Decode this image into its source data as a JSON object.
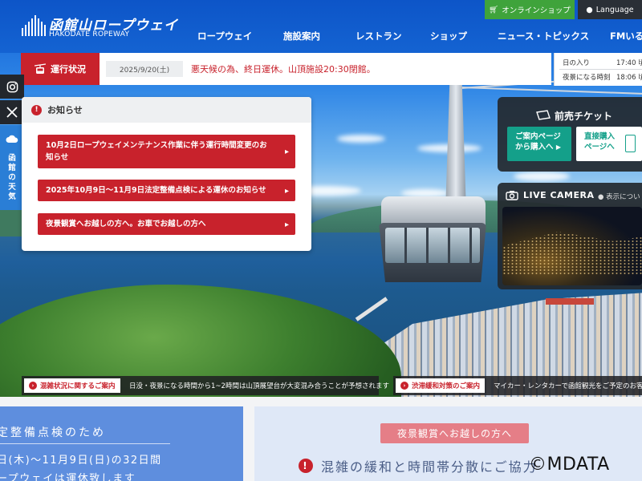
{
  "header": {
    "logo_jp": "函館山ロープウェイ",
    "logo_en": "HAKODATE ROPEWAY",
    "shop_label": "オンラインショップ",
    "lang_label": "Language",
    "nav": [
      "ロープウェイ",
      "施設案内",
      "レストラン",
      "ショップ",
      "ニュース・トピックス",
      "FMいる"
    ]
  },
  "status": {
    "label": "運行状況",
    "date": "2025/9/20(土)",
    "message": "悪天候の為、終日運休。山頂施設20:30閉館。"
  },
  "sun": {
    "sunset_label": "日の入り",
    "sunset_time": "17:40 頃",
    "night_label": "夜景になる時刻",
    "night_time": "18:06 頃"
  },
  "weather": {
    "label": "函館の天気"
  },
  "news": {
    "title": "お知らせ",
    "items": [
      "10月2日ロープウェイメンテナンス作業に伴う運行時間変更のお知らせ",
      "2025年10月9日～11月9日法定整備点検による運休のお知らせ",
      "夜景観賞へお越しの方へ。お車でお越しの方へ"
    ]
  },
  "ticket": {
    "title": "前売チケット",
    "btn_guide_line1": "ご案内ページ",
    "btn_guide_line2": "から購入へ",
    "btn_direct_line1": "直接購入",
    "btn_direct_line2": "ページへ"
  },
  "live": {
    "title": "LIVE CAMERA",
    "note": "表示につい"
  },
  "tickers": [
    {
      "label": "混雑状況に関するご案内",
      "text": "日没・夜景になる時間から1~2時間は山頂展望台が大変混み合うことが予想されます"
    },
    {
      "label": "渋滞緩和対策のご案内",
      "text": "マイカー・レンタカーで函館観光をご予定のお客様へ"
    }
  ],
  "card_left": {
    "line1": "定整備点検のため",
    "line2": "日(木)～11月9日(日)の32日間",
    "line3": "ープウェイは運休致します"
  },
  "card_right": {
    "tag": "夜景観賞へお越しの方へ",
    "text": "混雑の緩和と時間帯分散にご協力"
  },
  "watermark": "©MDATA",
  "colors": {
    "brand_blue": "#1463d2",
    "alert_red": "#c8222c",
    "shop_green": "#3fa33b",
    "ticket_teal": "#14a08a"
  }
}
